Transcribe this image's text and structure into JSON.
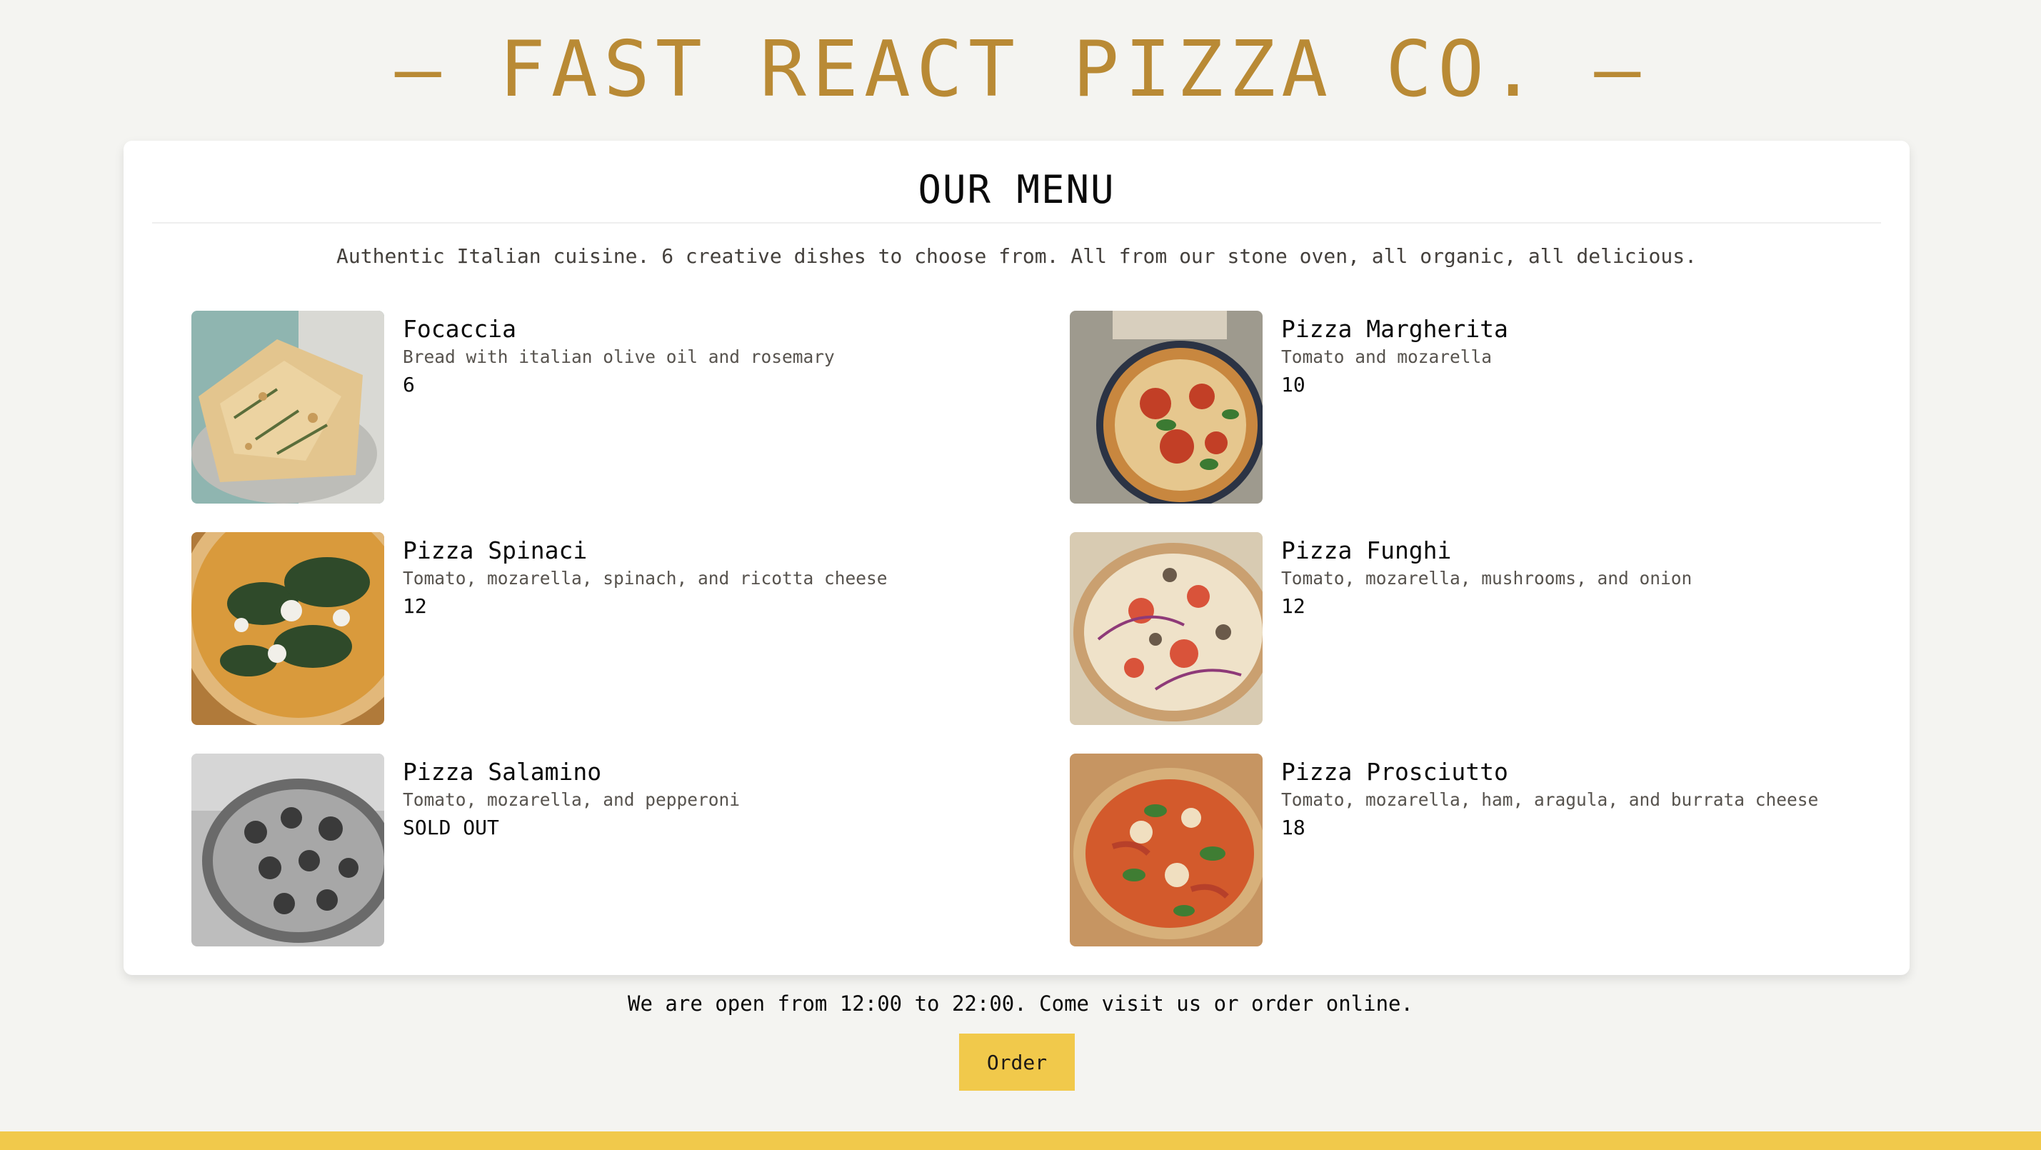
{
  "header": {
    "title": "— FAST REACT PIZZA CO. —"
  },
  "menu": {
    "title": "OUR MENU",
    "subtitle": "Authentic Italian cuisine. 6 creative dishes to choose from. All from our stone oven, all organic, all delicious.",
    "pizzas": [
      {
        "name": "Focaccia",
        "ingredients": "Bread with italian olive oil and rosemary",
        "price": "6",
        "image": "focaccia-photo"
      },
      {
        "name": "Pizza Margherita",
        "ingredients": "Tomato and mozarella",
        "price": "10",
        "image": "margherita-photo"
      },
      {
        "name": "Pizza Spinaci",
        "ingredients": "Tomato, mozarella, spinach, and ricotta cheese",
        "price": "12",
        "image": "spinaci-photo"
      },
      {
        "name": "Pizza Funghi",
        "ingredients": "Tomato, mozarella, mushrooms, and onion",
        "price": "12",
        "image": "funghi-photo"
      },
      {
        "name": "Pizza Salamino",
        "ingredients": "Tomato, mozarella, and pepperoni",
        "price": "SOLD OUT",
        "image": "salamino-photo-grayscale"
      },
      {
        "name": "Pizza Prosciutto",
        "ingredients": "Tomato, mozarella, ham, aragula, and burrata cheese",
        "price": "18",
        "image": "prosciutto-photo"
      }
    ]
  },
  "footer": {
    "opening_text": "We are open from 12:00 to 22:00. Come visit us or order online.",
    "order_label": "Order"
  },
  "colors": {
    "brand": "#b98a35",
    "accent": "#f1c94b",
    "background": "#f4f4f1"
  }
}
